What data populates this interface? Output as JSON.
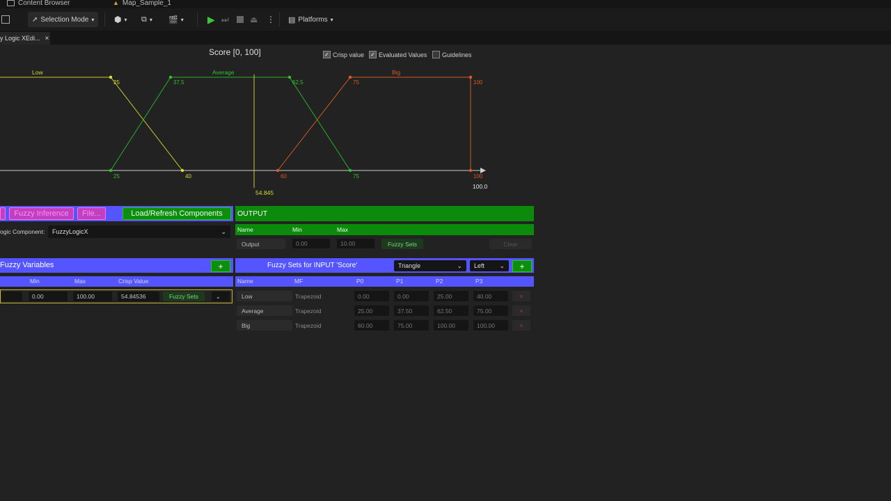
{
  "tabs": {
    "content_browser": "Content Browser",
    "map": "Map_Sample_1"
  },
  "toolbar": {
    "selection_mode": "Selection Mode",
    "platforms": "Platforms"
  },
  "editor_tab": {
    "title": "y Logic XEdi...",
    "close": "×"
  },
  "graph": {
    "title": "Score [0, 100]",
    "options": [
      {
        "label": "Crisp value",
        "checked": true
      },
      {
        "label": "Evaluated Values",
        "checked": true
      },
      {
        "label": "Guidelines",
        "checked": false
      }
    ],
    "sets": [
      {
        "name": "Low",
        "color": "#d8d830"
      },
      {
        "name": "Average",
        "color": "#30c030"
      },
      {
        "name": "Big",
        "color": "#d85a20"
      }
    ],
    "point_labels": [
      "25",
      "37.5",
      "62.5",
      "75",
      "100",
      "25",
      "40",
      "60",
      "75",
      "100"
    ],
    "axis_max_label": "100.0",
    "crisp_label": "54.845"
  },
  "left_panel": {
    "buttons": {
      "fuzzy_inference": "Fuzzy Inference",
      "file": "File...",
      "load_refresh": "Load/Refresh Components"
    },
    "component_label": "ogic Component:",
    "component_value": "FuzzyLogicX",
    "variables_title": "Fuzzy Variables",
    "add_label": "+",
    "columns": [
      "Min",
      "Max",
      "Crisp Value"
    ],
    "row": {
      "min": "0.00",
      "max": "100.00",
      "crisp": "54.84536",
      "fuzzy_sets": "Fuzzy Sets"
    }
  },
  "output_panel": {
    "title": "OUTPUT",
    "columns": [
      "Name",
      "Min",
      "Max"
    ],
    "row": {
      "name": "Output",
      "min": "0.00",
      "max": "10.00",
      "fuzzy_sets": "Fuzzy Sets",
      "clear": "Clear"
    }
  },
  "sets_panel": {
    "title": "Fuzzy Sets for INPUT 'Score'",
    "mf_type": "Triangle",
    "side": "Left",
    "add_label": "+",
    "columns": [
      "Name",
      "MF",
      "P0",
      "P1",
      "P2",
      "P3"
    ],
    "rows": [
      {
        "name": "Low",
        "mf": "Trapezoid",
        "p0": "0.00",
        "p1": "0.00",
        "p2": "25.00",
        "p3": "40.00"
      },
      {
        "name": "Average",
        "mf": "Trapezoid",
        "p0": "25.00",
        "p1": "37.50",
        "p2": "62.50",
        "p3": "75.00"
      },
      {
        "name": "Big",
        "mf": "Trapezoid",
        "p0": "60.00",
        "p1": "75.00",
        "p2": "100.00",
        "p3": "100.00"
      }
    ],
    "delete_label": "×"
  }
}
